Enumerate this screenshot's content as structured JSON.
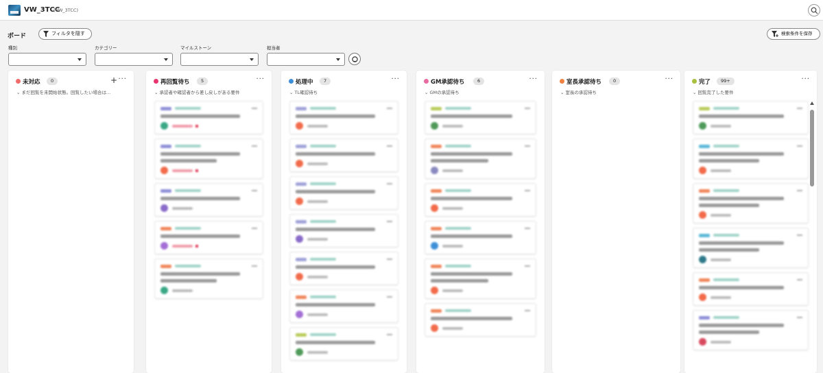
{
  "header": {
    "title": "VW_3TCC",
    "subtitle": "(VW_3TCC)"
  },
  "toolbar": {
    "board_label": "ボード",
    "filter_label": "フィルタを隠す",
    "save_label": "検索条件を保存"
  },
  "filters": [
    {
      "label": "種別",
      "value": ""
    },
    {
      "label": "カテゴリー",
      "value": ""
    },
    {
      "label": "マイルストーン",
      "value": ""
    },
    {
      "label": "担当者",
      "value": ""
    }
  ],
  "columns": [
    {
      "title": "未対応",
      "count": "0",
      "color": "#f26b6b",
      "description": "まだ回覧を未開始状態。回覧したい場合は...",
      "has_add": true,
      "cards": []
    },
    {
      "title": "再回覧待ち",
      "count": "5",
      "color": "#e8356f",
      "description": "承認者や確認者から差し戻しがある要件",
      "has_add": false,
      "cards": [
        {
          "tag": "#8e8fd8",
          "lines": 1,
          "avatar": "#3aa886",
          "red": true
        },
        {
          "tag": "#8e8fd8",
          "lines": 2,
          "avatar": "#f26b4a",
          "red": true
        },
        {
          "tag": "#8e8fd8",
          "lines": 1,
          "avatar": "#8a6bc9",
          "red": false
        },
        {
          "tag": "#f0855a",
          "lines": 1,
          "avatar": "#a46fd6",
          "red": true
        },
        {
          "tag": "#f0855a",
          "lines": 2,
          "avatar": "#3aa886",
          "red": false
        }
      ]
    },
    {
      "title": "処理中",
      "count": "7",
      "color": "#3f8fd8",
      "description": "TL確認待ち",
      "has_add": false,
      "cards": [
        {
          "tag": "#9ea0d8",
          "lines": 1,
          "avatar": "#f26b4a",
          "red": false
        },
        {
          "tag": "#9ea0d8",
          "lines": 1,
          "avatar": "#f26b4a",
          "red": false
        },
        {
          "tag": "#9ea0d8",
          "lines": 1,
          "avatar": "#f26b4a",
          "red": false
        },
        {
          "tag": "#9ea0d8",
          "lines": 1,
          "avatar": "#8a6bc9",
          "red": false
        },
        {
          "tag": "#9ea0d8",
          "lines": 1,
          "avatar": "#f26b4a",
          "red": false
        },
        {
          "tag": "#f0855a",
          "lines": 1,
          "avatar": "#a46fd6",
          "red": false
        },
        {
          "tag": "#b8cc5a",
          "lines": 1,
          "avatar": "#4f9a5a",
          "red": false
        }
      ]
    },
    {
      "title": "GM承認待ち",
      "count": "6",
      "color": "#e86aa0",
      "description": "GMの承認待ち",
      "has_add": false,
      "cards": [
        {
          "tag": "#b8cc5a",
          "lines": 1,
          "avatar": "#4f9a5a",
          "red": false
        },
        {
          "tag": "#f0855a",
          "lines": 2,
          "avatar": "#8a8ac0",
          "red": false
        },
        {
          "tag": "#f0855a",
          "lines": 1,
          "avatar": "#f26b4a",
          "red": false
        },
        {
          "tag": "#f0855a",
          "lines": 1,
          "avatar": "#3f8fd8",
          "red": false
        },
        {
          "tag": "#f0855a",
          "lines": 2,
          "avatar": "#f26b4a",
          "red": false
        },
        {
          "tag": "#f0855a",
          "lines": 1,
          "avatar": "#f26b4a",
          "red": false
        }
      ]
    },
    {
      "title": "室長承認待ち",
      "count": "0",
      "color": "#f08040",
      "description": "室長の承認待ち",
      "has_add": false,
      "cards": []
    },
    {
      "title": "完了",
      "count": "99+",
      "color": "#a8c040",
      "description": "回覧完了した要件",
      "has_add": false,
      "cards": [
        {
          "tag": "#b8cc5a",
          "lines": 1,
          "avatar": "#4f9a5a",
          "red": false
        },
        {
          "tag": "#5ab8d8",
          "lines": 2,
          "avatar": "#f26b4a",
          "red": false
        },
        {
          "tag": "#f0855a",
          "lines": 2,
          "avatar": "#f26b4a",
          "red": false
        },
        {
          "tag": "#5ab8d8",
          "lines": 2,
          "avatar": "#2f7a8a",
          "red": false
        },
        {
          "tag": "#f0855a",
          "lines": 1,
          "avatar": "#f26b4a",
          "red": false
        },
        {
          "tag": "#8e8fd8",
          "lines": 2,
          "avatar": "#d84a60",
          "red": false
        }
      ]
    }
  ]
}
